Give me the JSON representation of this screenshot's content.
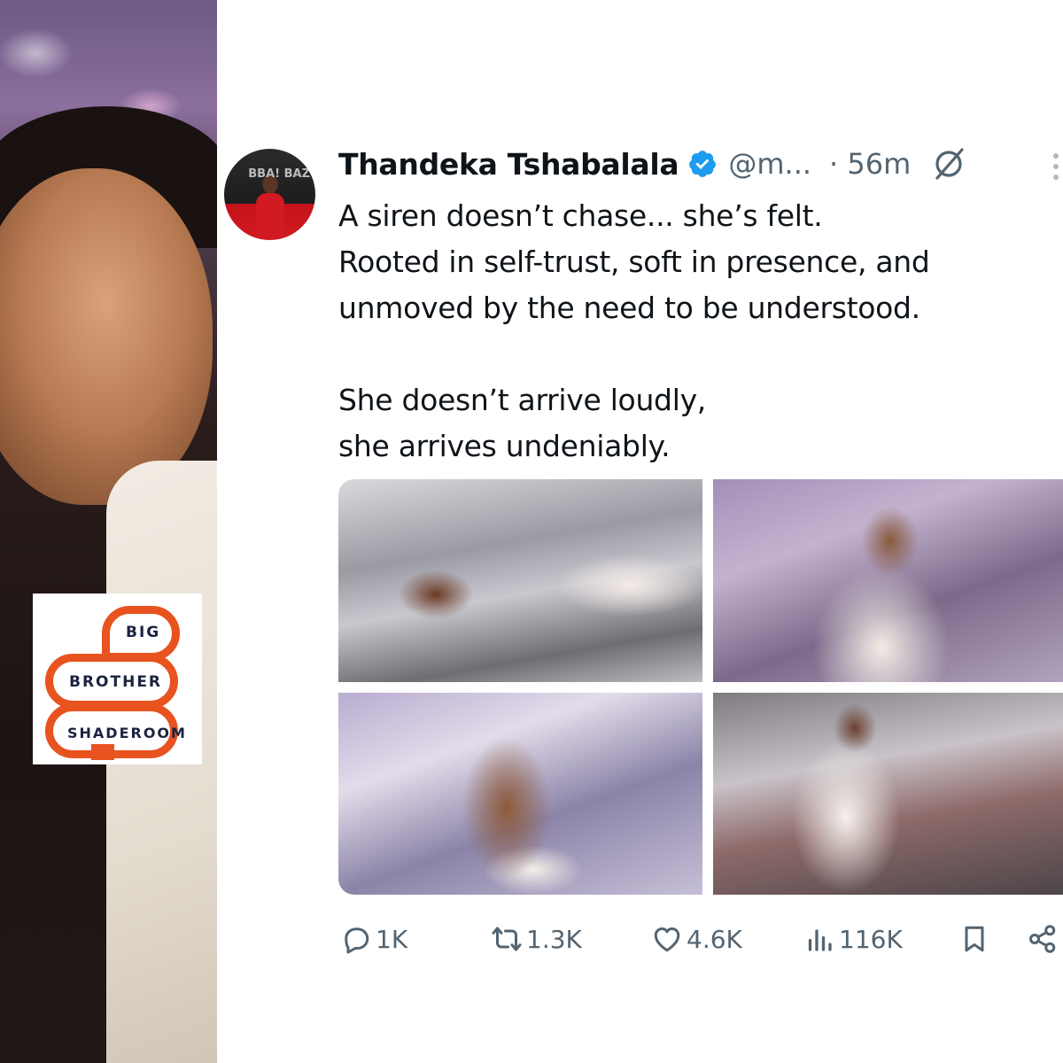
{
  "logo": {
    "line1": "BIG",
    "line2": "BROTHER",
    "line3": "SHADEROOM",
    "accent_color": "#e8531f",
    "text_color": "#1b2340"
  },
  "tweet": {
    "display_name": "Thandeka Tshabalala",
    "verified": true,
    "verified_color": "#1d9bf0",
    "handle": "@m...",
    "time": "· 56m",
    "avatar_text": "BBA! BAZ",
    "text_lines": [
      "A siren doesn’t chase... she’s felt.",
      "Rooted in self-trust, soft in presence, and",
      "unmoved by the need to be understood.",
      "She doesn’t arrive loudly,",
      "she arrives undeniably."
    ],
    "media_count": 4,
    "icons": [
      "grok-icon",
      "more-icon"
    ]
  },
  "actions": {
    "replies": "1K",
    "retweets": "1.3K",
    "likes": "4.6K",
    "views": "116K"
  }
}
